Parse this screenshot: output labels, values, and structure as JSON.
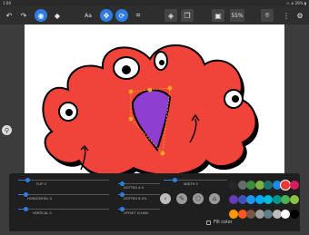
{
  "status": {
    "time": "1:00",
    "right": "⚠ ⊛ 29% ▮"
  },
  "toolbar": {
    "undo_icon": "↶",
    "redo_icon": "↷",
    "brush_icon": "◉",
    "eraser_icon": "◆",
    "text_icon": "Aa",
    "move_icon": "✥",
    "rotate_icon": "⟳",
    "crop_icon": "⌗",
    "layers_icon": "◈",
    "copy_icon": "❐",
    "image_icon": "▣",
    "zoom_label": "55%",
    "effects_icon": "⌾",
    "more_icon": "⋮",
    "settings_icon": "⚙"
  },
  "zoom_button": "⚲",
  "panel": {
    "sliders": [
      {
        "label": "FLIP 0",
        "value": 0.1
      },
      {
        "label": "HORIZONTAL 0",
        "value": 0.08
      },
      {
        "label": "VERTICAL 0",
        "value": 0.08
      },
      {
        "label": "DOTTED A 0",
        "value": 0.05
      },
      {
        "label": "DOTTED B 0%",
        "value": 0.05
      },
      {
        "label": "OFFSET 0/1600",
        "value": 0.05
      },
      {
        "label": "WIDTH 5",
        "value": 0.18
      }
    ],
    "actions": {
      "prev": "‹",
      "brush": "✎",
      "pentagon": "⬠",
      "image": "⌂"
    },
    "fill_color_label": "Fill color",
    "palette": [
      "#262626",
      "#6b6b6b",
      "#3d8b3d",
      "#7cb342",
      "#1e6f6b",
      "#1e88e5",
      "#e53935",
      "#d81b60",
      "#673ab7",
      "#3f51b5",
      "#2196f3",
      "#03a9f4",
      "#00bcd4",
      "#009688",
      "#4caf50",
      "#8bc34a",
      "#ff9800",
      "#ff5722",
      "#795548",
      "#9e9e9e",
      "#607d8b",
      "#bdbdbd",
      "#ffffff",
      "#000000"
    ]
  },
  "drawing": {
    "body": "#f0433a",
    "outline": "#000000",
    "mouth": "#8e3fd1",
    "handle": "#f5a623"
  }
}
